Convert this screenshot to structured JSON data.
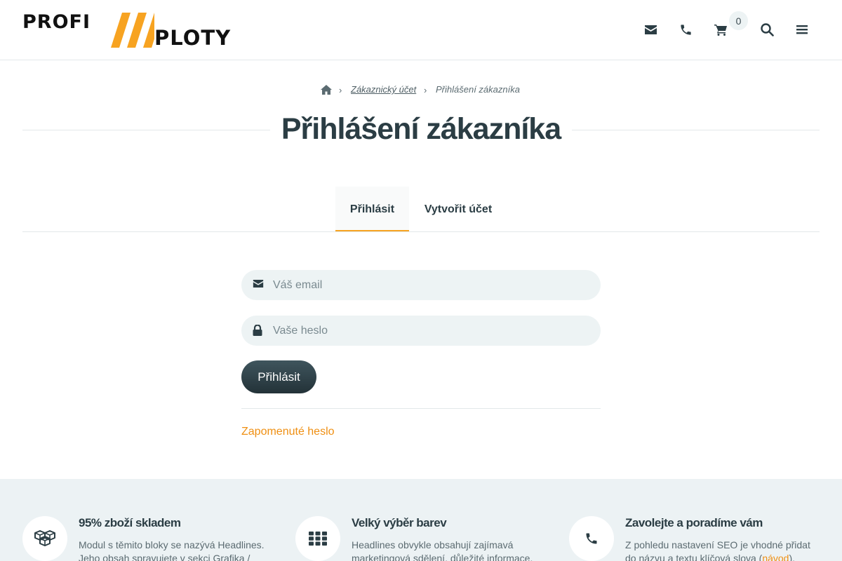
{
  "brand": {
    "word1": "PROFI",
    "word2": "PLOTY",
    "slash_color": "#f7a321"
  },
  "header": {
    "icons": [
      "envelope-icon",
      "phone-icon",
      "cart-icon",
      "search-icon",
      "menu-icon"
    ],
    "cart_count": "0"
  },
  "breadcrumb": {
    "home_icon": "home-icon",
    "separator": "›",
    "link": "Zákaznický účet",
    "current": "Přihlášení zákazníka"
  },
  "page": {
    "title": "Přihlášení zákazníka"
  },
  "tabs": [
    {
      "label": "Přihlásit",
      "active": true
    },
    {
      "label": "Vytvořit účet",
      "active": false
    }
  ],
  "form": {
    "email_placeholder": "Váš email",
    "email_value": "",
    "password_placeholder": "Vaše heslo",
    "password_value": "",
    "submit_label": "Přihlásit",
    "forgot_label": "Zapomenuté heslo"
  },
  "headlines": [
    {
      "icon": "boxes-icon",
      "title": "95% zboží skladem",
      "text": "Modul s těmito bloky se nazývá Headlines. Jeho obsah spravujete v sekci Grafika /"
    },
    {
      "icon": "grid-icon",
      "title": "Velký výběr barev",
      "text": "Headlines obvykle obsahují zajímavá marketingová sdělení, důležité informace."
    },
    {
      "icon": "phone-icon",
      "title": "Zavolejte a poradíme vám",
      "text_before": "Z pohledu nastavení SEO je vhodné přidat do názvu a textu klíčová slova (",
      "link": "návod",
      "text_after": ")."
    }
  ],
  "colors": {
    "accent": "#f7a321",
    "link": "#ef8f12",
    "text": "#2b3d44",
    "field_bg": "#edf3f4",
    "footer_bg": "#ecf2f4"
  }
}
